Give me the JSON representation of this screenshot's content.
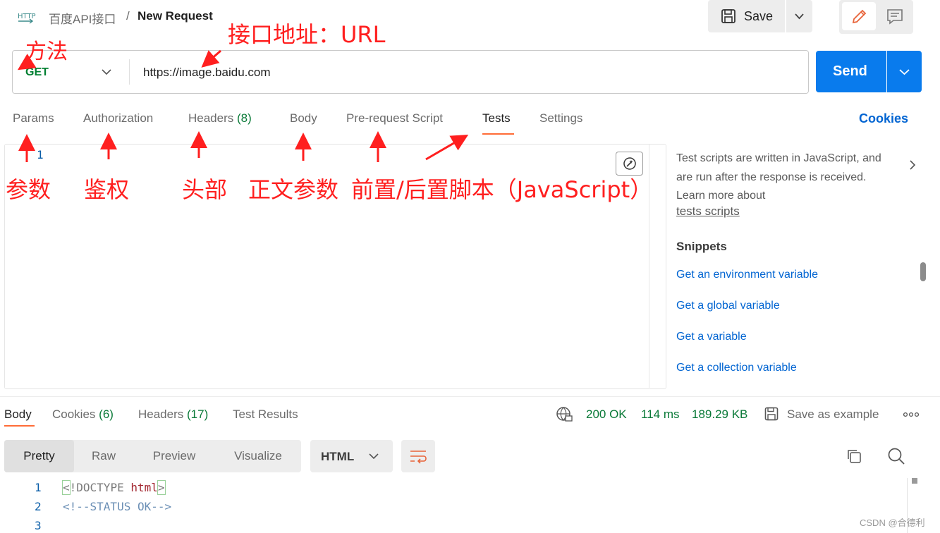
{
  "header": {
    "protocol_icon": "HTTP",
    "breadcrumb_parent": "百度API接口",
    "breadcrumb_separator": "/",
    "request_name": "New Request",
    "save_label": "Save"
  },
  "request": {
    "method": "GET",
    "url": "https://image.baidu.com",
    "send_label": "Send"
  },
  "request_tabs": [
    {
      "label": "Params",
      "count": ""
    },
    {
      "label": "Authorization",
      "count": ""
    },
    {
      "label": "Headers",
      "count": "(8)"
    },
    {
      "label": "Body",
      "count": ""
    },
    {
      "label": "Pre-request Script",
      "count": ""
    },
    {
      "label": "Tests",
      "count": "",
      "active": true
    },
    {
      "label": "Settings",
      "count": ""
    }
  ],
  "cookies_label": "Cookies",
  "editor": {
    "line_numbers": [
      "1"
    ]
  },
  "side_panel": {
    "description": "Test scripts are written in JavaScript, and are run after the response is received. Learn more about",
    "link": "tests scripts",
    "snippets_title": "Snippets",
    "snippets": [
      "Get an environment variable",
      "Get a global variable",
      "Get a variable",
      "Get a collection variable"
    ]
  },
  "response": {
    "tabs": [
      {
        "label": "Body",
        "count": "",
        "active": true
      },
      {
        "label": "Cookies",
        "count": "(6)"
      },
      {
        "label": "Headers",
        "count": "(17)"
      },
      {
        "label": "Test Results",
        "count": ""
      }
    ],
    "status": "200 OK",
    "time": "114 ms",
    "size": "189.29 KB",
    "save_example": "Save as example",
    "view_modes": [
      "Pretty",
      "Raw",
      "Preview",
      "Visualize"
    ],
    "format": "HTML",
    "code": {
      "line_numbers": [
        "1",
        "2",
        "3"
      ],
      "line1_open": "<",
      "line1_text": "!DOCTYPE ",
      "line1_tag": "html",
      "line1_close": ">",
      "line2": "<!--STATUS OK-->"
    }
  },
  "annotations": {
    "method": "方法",
    "url": "接口地址：URL",
    "params": "参数",
    "auth": "鉴权",
    "headers": "头部",
    "body": "正文参数",
    "scripts": "前置/后置脚本（JavaScript）"
  },
  "watermark": "CSDN @合德利",
  "colors": {
    "accent": "#ff6c37",
    "send": "#097bed",
    "success": "#0a7a38",
    "link": "#0265d2",
    "annotation": "#ff1f1f"
  }
}
